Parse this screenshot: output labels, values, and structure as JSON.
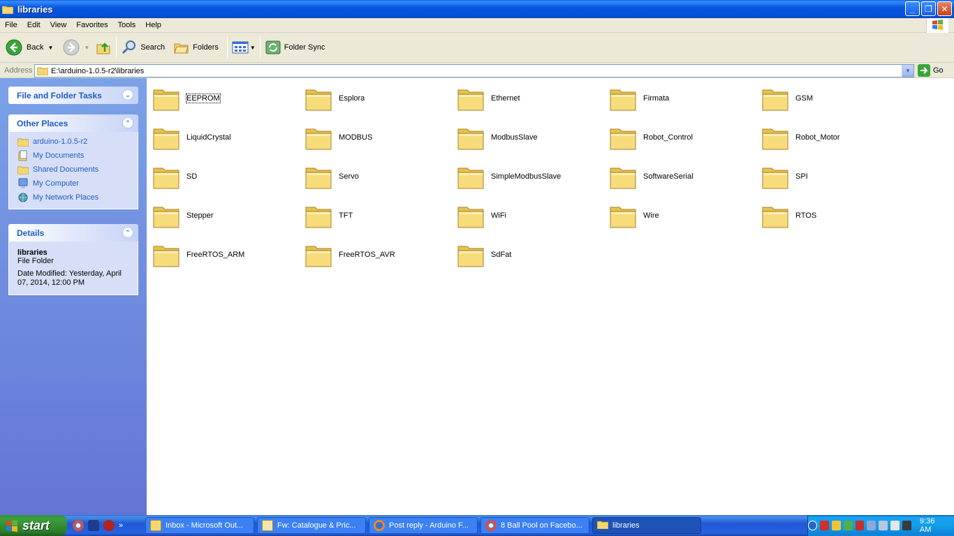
{
  "window": {
    "title": "libraries"
  },
  "menu": [
    "File",
    "Edit",
    "View",
    "Favorites",
    "Tools",
    "Help"
  ],
  "toolbar": {
    "back": "Back",
    "search": "Search",
    "folders": "Folders",
    "folder_sync": "Folder Sync"
  },
  "address": {
    "label": "Address",
    "value": "E:\\arduino-1.0.5-r2\\libraries",
    "go": "Go"
  },
  "left_pane": {
    "tasks_title": "File and Folder Tasks",
    "other_places_title": "Other Places",
    "other_places": [
      {
        "label": "arduino-1.0.5-r2",
        "icon": "folder-icon"
      },
      {
        "label": "My Documents",
        "icon": "my-documents-icon"
      },
      {
        "label": "Shared Documents",
        "icon": "folder-icon"
      },
      {
        "label": "My Computer",
        "icon": "my-computer-icon"
      },
      {
        "label": "My Network Places",
        "icon": "network-places-icon"
      }
    ],
    "details_title": "Details",
    "details": {
      "name": "libraries",
      "type": "File Folder",
      "modified_1": "Date Modified: Yesterday, April",
      "modified_2": "07, 2014, 12:00 PM"
    }
  },
  "folders": [
    "EEPROM",
    "Esplora",
    "Ethernet",
    "Firmata",
    "GSM",
    "LiquidCrystal",
    "MODBUS",
    "ModbusSlave",
    "Robot_Control",
    "Robot_Motor",
    "SD",
    "Servo",
    "SimpleModbusSlave",
    "SoftwareSerial",
    "SPI",
    "Stepper",
    "TFT",
    "WiFi",
    "Wire",
    "RTOS",
    "FreeRTOS_ARM",
    "FreeRTOS_AVR",
    "SdFat"
  ],
  "taskbar": {
    "start": "start",
    "tasks": [
      {
        "label": "Inbox - Microsoft Out...",
        "icon": "outlook-icon"
      },
      {
        "label": "Fw: Catalogue & Pric...",
        "icon": "mail-icon"
      },
      {
        "label": "Post reply - Arduino F...",
        "icon": "firefox-icon"
      },
      {
        "label": "8 Ball Pool on Facebo...",
        "icon": "chrome-icon"
      },
      {
        "label": "libraries",
        "icon": "folder-icon"
      }
    ],
    "clock": "9:36 AM"
  },
  "colors": {
    "titlebar": "#0758e3",
    "link": "#215dc6",
    "folder": "#f5d770"
  }
}
